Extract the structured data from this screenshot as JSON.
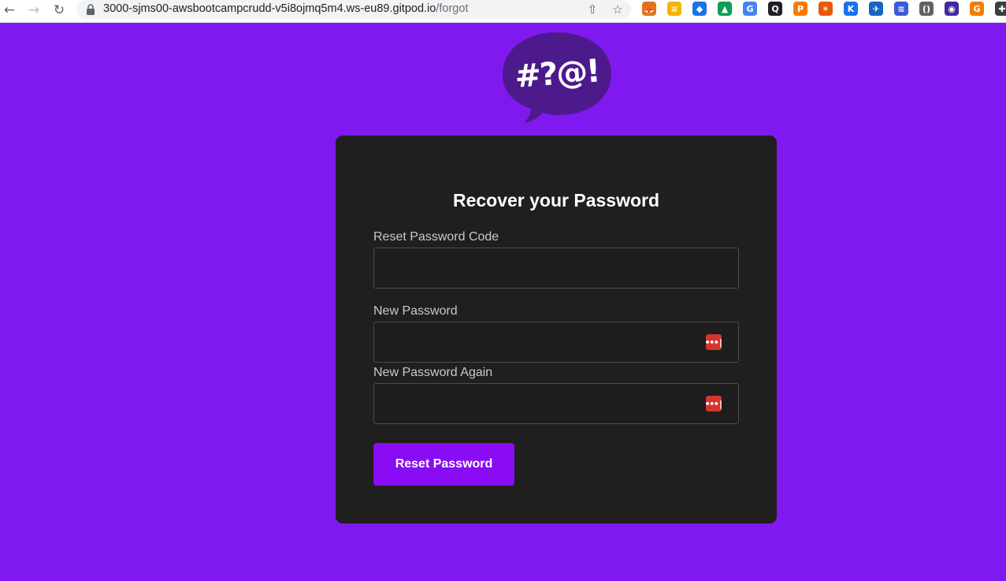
{
  "browser": {
    "url_host": "3000-sjms00-awsbootcampcrudd-v5i8ojmq5m4.ws-eu89.gitpod.io",
    "url_path": "/forgot",
    "back_icon": "back-arrow",
    "forward_icon": "forward-arrow",
    "reload_icon": "reload",
    "share_icon": "share",
    "bookmark_icon": "star",
    "extensions": [
      {
        "name": "metamask-icon",
        "glyph": "🦊",
        "color": "#e2761b"
      },
      {
        "name": "notes-extension-icon",
        "glyph": "≡",
        "color": "#f4b400"
      },
      {
        "name": "ethereum-icon",
        "glyph": "◆",
        "color": "#1a73e8"
      },
      {
        "name": "google-drive-icon",
        "glyph": "▲",
        "color": "#0f9d58"
      },
      {
        "name": "google-translate-icon",
        "glyph": "G",
        "color": "#4285f4"
      },
      {
        "name": "search-extension-icon",
        "glyph": "Q",
        "color": "#202124"
      },
      {
        "name": "p-extension-icon",
        "glyph": "P",
        "color": "#f57c00"
      },
      {
        "name": "asterisk-extension-icon",
        "glyph": "✴",
        "color": "#e8590c"
      },
      {
        "name": "k-extension-icon",
        "glyph": "K",
        "color": "#1a73e8"
      },
      {
        "name": "plane-extension-icon",
        "glyph": "✈",
        "color": "#1565c0"
      },
      {
        "name": "stack-extension-icon",
        "glyph": "≋",
        "color": "#3b5bdb"
      },
      {
        "name": "braces-extension-icon",
        "glyph": "()",
        "color": "#5f6368"
      },
      {
        "name": "bot-extension-icon",
        "glyph": "◉",
        "color": "#4527a0"
      },
      {
        "name": "g-extension-icon",
        "glyph": "G",
        "color": "#f57c00"
      },
      {
        "name": "puzzle-extensions-icon",
        "glyph": "✚",
        "color": "#3c4043"
      }
    ]
  },
  "logo": {
    "text": "#?@!"
  },
  "form": {
    "title": "Recover your Password",
    "code_label": "Reset Password Code",
    "code_value": "",
    "password_label": "New Password",
    "password_value": "",
    "password_again_label": "New Password Again",
    "password_again_value": "",
    "submit_label": "Reset Password"
  },
  "colors": {
    "background": "#8019ef",
    "card": "#1f1f1f",
    "button": "#8a0cf5",
    "logo_bubble": "#4d1a8c",
    "password_manager_icon": "#d6352c"
  }
}
